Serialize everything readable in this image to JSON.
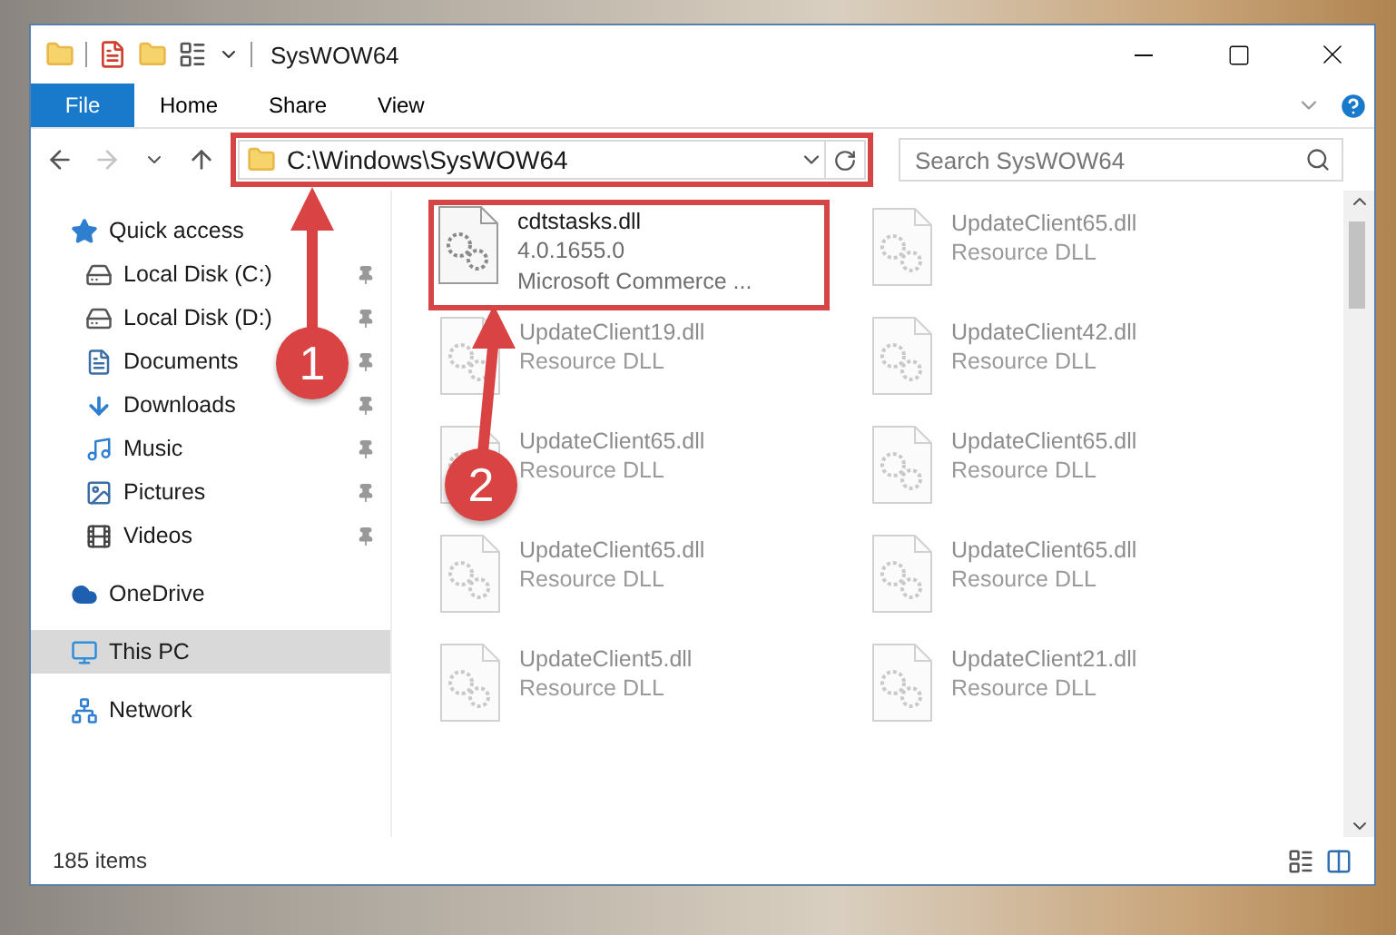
{
  "window": {
    "title": "SysWOW64"
  },
  "ribbon": {
    "file_button": "File",
    "tabs": [
      "Home",
      "Share",
      "View"
    ]
  },
  "navigation": {
    "back": {
      "disabled": false
    },
    "forward": {
      "disabled": true
    }
  },
  "address": {
    "path": "C:\\Windows\\SysWOW64",
    "highlighted": true
  },
  "search": {
    "placeholder": "Search SysWOW64"
  },
  "sidebar": {
    "items": [
      {
        "label": "Quick access",
        "kind": "quick",
        "selected": false,
        "children": [
          {
            "label": "Local Disk (C:)",
            "kind": "system-drive",
            "pinned": true,
            "selected": false
          },
          {
            "label": "Local Disk (D:)",
            "kind": "drive",
            "pinned": true,
            "selected": false
          },
          {
            "label": "Documents",
            "kind": "documents",
            "pinned": true,
            "selected": false
          },
          {
            "label": "Downloads",
            "kind": "downloads",
            "pinned": true,
            "selected": false
          },
          {
            "label": "Music",
            "kind": "music",
            "pinned": true,
            "selected": false
          },
          {
            "label": "Pictures",
            "kind": "pictures",
            "pinned": true,
            "selected": false
          },
          {
            "label": "Videos",
            "kind": "videos",
            "pinned": true,
            "selected": false
          }
        ]
      },
      {
        "label": "OneDrive",
        "kind": "cloud",
        "selected": false
      },
      {
        "label": "This PC",
        "kind": "pc",
        "selected": true
      },
      {
        "label": "Network",
        "kind": "network",
        "selected": false
      }
    ]
  },
  "files": [
    {
      "name": "cdtstasks.dll",
      "details": [
        "4.0.1655.0",
        "Microsoft Commerce ..."
      ],
      "faded": false,
      "highlighted": true
    },
    {
      "name": "UpdateClient65.dll",
      "details": [
        "Resource DLL"
      ],
      "faded": true
    },
    {
      "name": "UpdateClient19.dll",
      "details": [
        "Resource DLL"
      ],
      "faded": true
    },
    {
      "name": "UpdateClient42.dll",
      "details": [
        "Resource DLL"
      ],
      "faded": true
    },
    {
      "name": "UpdateClient65.dll",
      "details": [
        "Resource DLL"
      ],
      "faded": true
    },
    {
      "name": "UpdateClient65.dll",
      "details": [
        "Resource DLL"
      ],
      "faded": true
    },
    {
      "name": "UpdateClient65.dll",
      "details": [
        "Resource DLL"
      ],
      "faded": true
    },
    {
      "name": "UpdateClient65.dll",
      "details": [
        "Resource DLL"
      ],
      "faded": true
    },
    {
      "name": "UpdateClient5.dll",
      "details": [
        "Resource DLL"
      ],
      "faded": true
    },
    {
      "name": "UpdateClient21.dll",
      "details": [
        "Resource DLL"
      ],
      "faded": true
    }
  ],
  "status_bar": {
    "count": "185 items"
  },
  "annotations": [
    {
      "number": "1"
    },
    {
      "number": "2"
    }
  ]
}
